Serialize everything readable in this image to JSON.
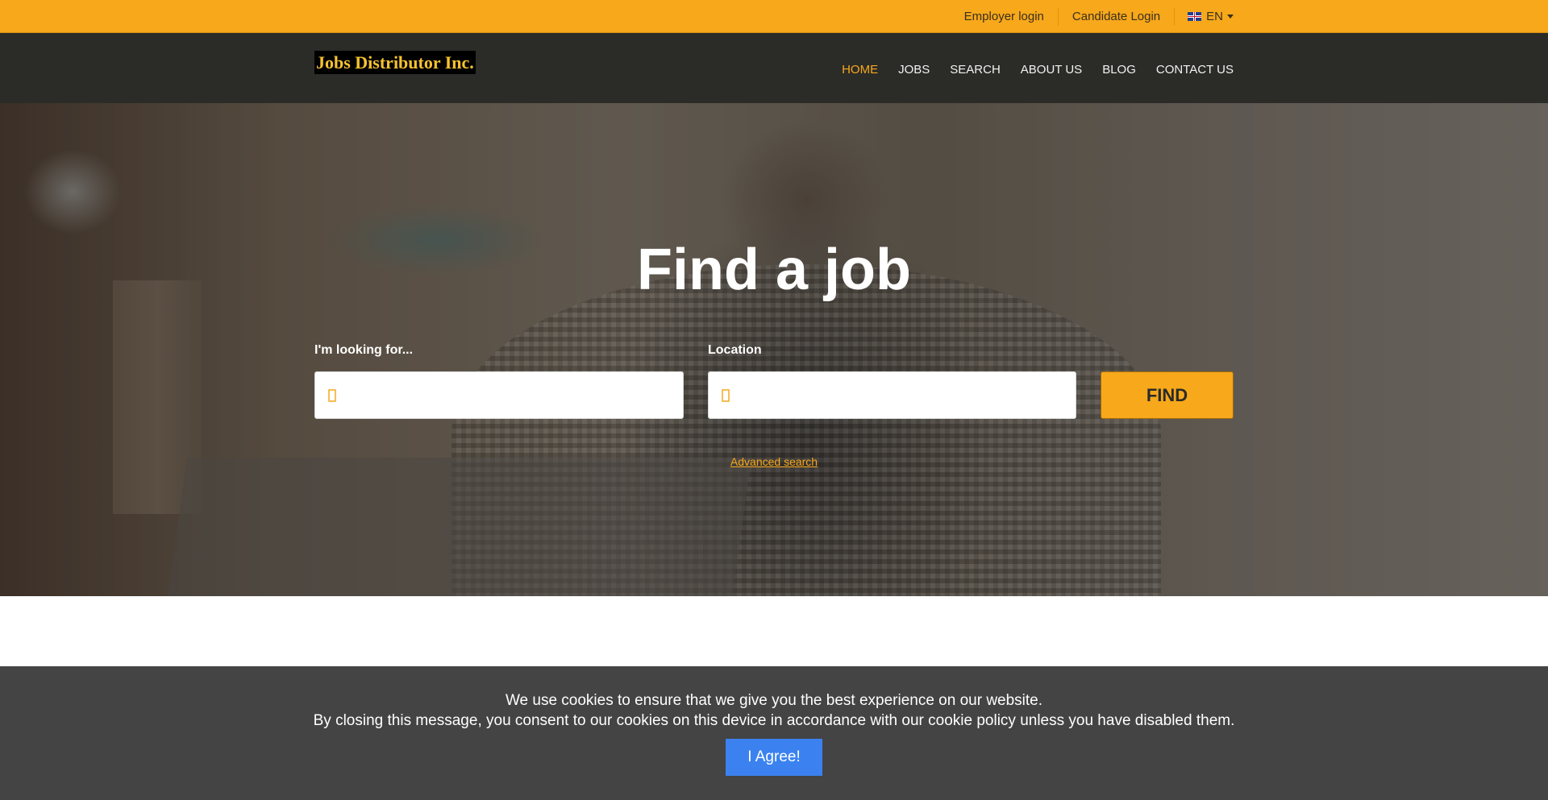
{
  "topbar": {
    "employer_login": "Employer login",
    "candidate_login": "Candidate Login",
    "language": "EN"
  },
  "header": {
    "logo_text": "Jobs Distributor Inc.",
    "nav": [
      "HOME",
      "JOBS",
      "SEARCH",
      "ABOUT US",
      "BLOG",
      "CONTACT US"
    ],
    "active_nav": "HOME"
  },
  "hero": {
    "title": "Find a job",
    "keyword_label": "I'm looking for...",
    "keyword_value": "",
    "location_label": "Location",
    "location_value": "",
    "find_button": "FIND",
    "advanced_search": "Advanced search"
  },
  "cookie_banner": {
    "line1": "We use cookies to ensure that we give you the best experience on our website.",
    "line2": "By closing this message, you consent to our cookies on this device in accordance with our cookie policy unless you have disabled them.",
    "button": "I Agree!"
  },
  "colors": {
    "accent": "#f7a81b",
    "nav_bg": "#2b2b28",
    "cookie_bg": "#444444",
    "agree_button": "#3b82f0"
  },
  "icons": {
    "keyword_field": "search-icon",
    "location_field": "map-marker-icon",
    "language": "uk-flag-icon"
  }
}
